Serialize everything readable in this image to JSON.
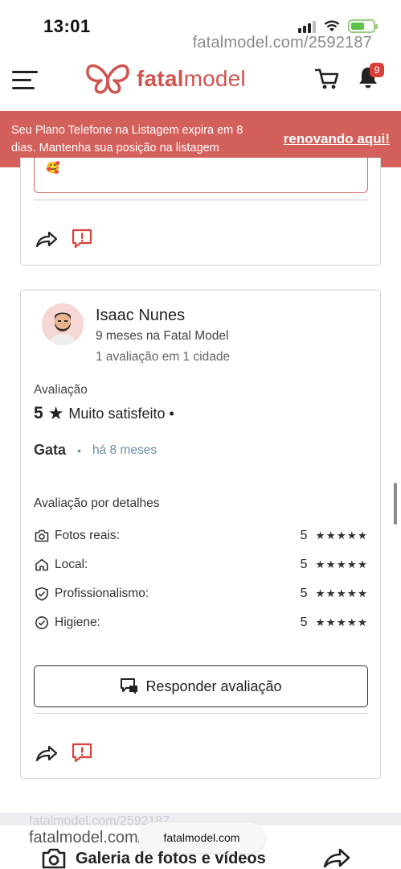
{
  "status_bar": {
    "time": "13:01",
    "watermark": "fatalmodel.com/2592187"
  },
  "header": {
    "logo_text_bold": "fatal",
    "logo_text_regular": "model",
    "notification_count": "9",
    "brand_color": "#d05450"
  },
  "banner": {
    "message": "Seu Plano Telefone na Listagem expira em 8 dias. Mantenha sua posição na listagem",
    "link_label": "renovando aqui!",
    "color": "#d4605b"
  },
  "previous_review": {
    "reply_emoji": "🥰"
  },
  "review": {
    "author_name": "Isaac Nunes",
    "member_since": "9 meses na Fatal Model",
    "review_count": "1 avaliação em 1 cidade",
    "rating_label": "Avaliação",
    "rating_value": "5",
    "rating_text": "Muito satisfeito •",
    "category": "Gata",
    "time_ago": "há 8 meses",
    "details_label": "Avaliação por detalhes",
    "details": [
      {
        "name": "Fotos reais:",
        "score": "5",
        "stars": "★★★★★",
        "icon": "camera-icon"
      },
      {
        "name": "Local:",
        "score": "5",
        "stars": "★★★★★",
        "icon": "home-icon"
      },
      {
        "name": "Profissionalismo:",
        "score": "5",
        "stars": "★★★★★",
        "icon": "shield-check-icon"
      },
      {
        "name": "Higiene:",
        "score": "5",
        "stars": "★★★★★",
        "icon": "check-circle-icon"
      }
    ],
    "reply_button_label": "Responder avaliação"
  },
  "bottom": {
    "ghost_watermark": "fatalmodel.com/2592187",
    "watermark": "fatalmodel.com/2592187",
    "url": "fatalmodel.com",
    "gallery_label": "Galeria de fotos e vídeos"
  }
}
